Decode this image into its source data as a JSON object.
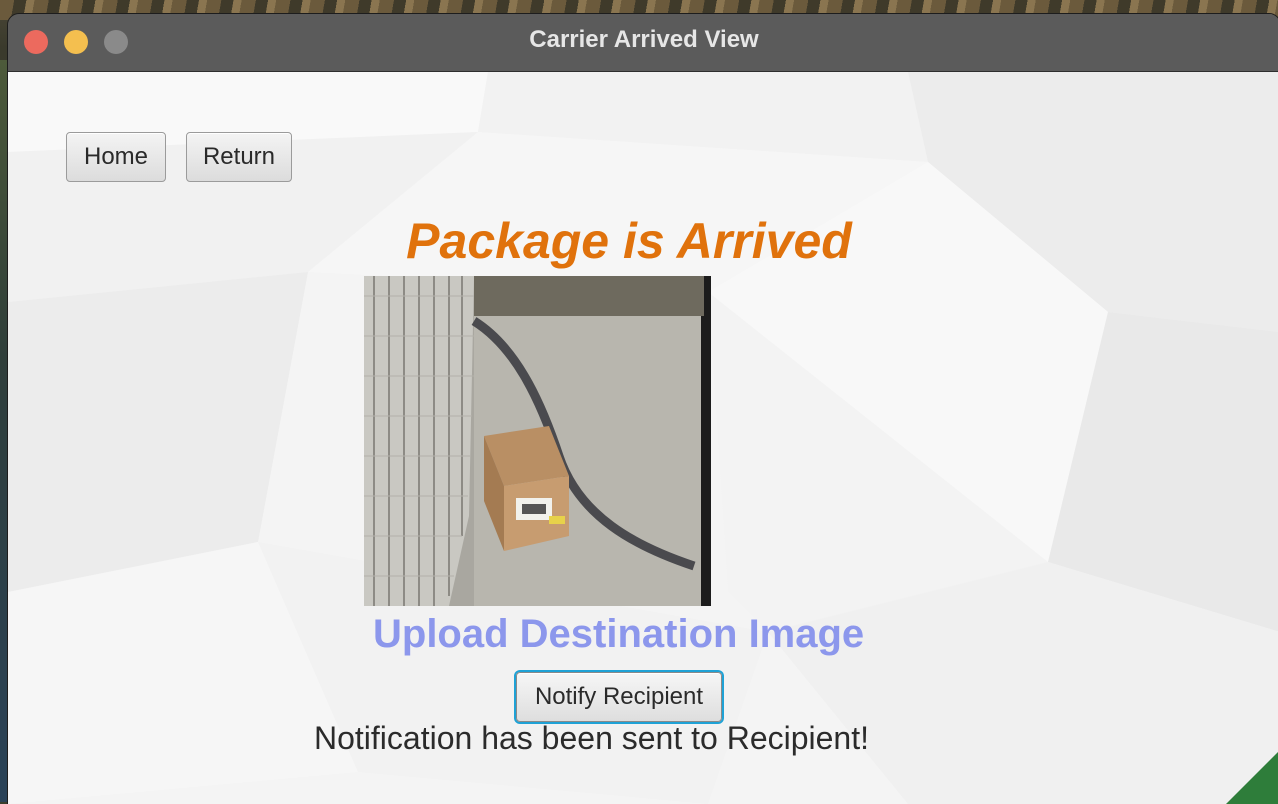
{
  "window": {
    "title": "Carrier Arrived View"
  },
  "nav": {
    "home_label": "Home",
    "return_label": "Return"
  },
  "main": {
    "heading": "Package is Arrived",
    "upload_label": "Upload Destination Image",
    "notify_label": "Notify Recipient",
    "status_text": "Notification has been sent to Recipient!"
  },
  "colors": {
    "heading": "#e0720c",
    "upload": "#8c97ec",
    "focus_ring": "#1fa2d6",
    "traffic_close": "#ec6a5e",
    "traffic_minimize": "#f4bf4f",
    "traffic_maximize": "#8a8a8a"
  }
}
